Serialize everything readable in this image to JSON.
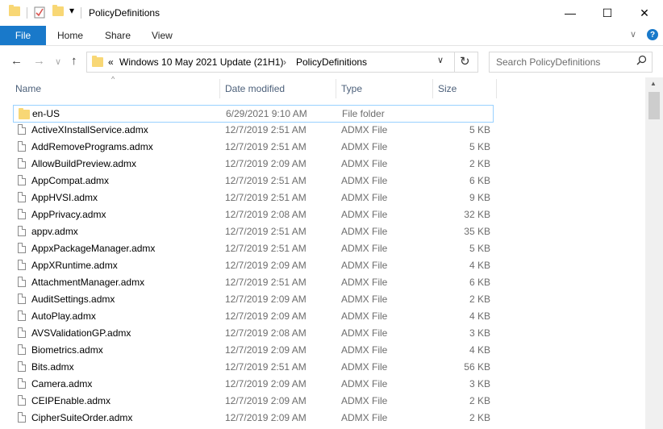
{
  "window": {
    "title": "PolicyDefinitions",
    "minimize_icon": "—",
    "maximize_icon": "☐",
    "close_icon": "✕"
  },
  "quick_access": {
    "dropdown_icon": "▾"
  },
  "ribbon": {
    "tabs": [
      "File",
      "Home",
      "Share",
      "View"
    ],
    "expand_icon": "∨",
    "help_icon": "?"
  },
  "navigation": {
    "back_icon": "←",
    "forward_icon": "→",
    "recent_icon": "∨",
    "up_icon": "↑",
    "overflow": "«",
    "breadcrumb": [
      "Windows 10 May 2021 Update (21H1)",
      "PolicyDefinitions"
    ],
    "crumb_sep": "›",
    "dropdown_icon": "∨",
    "refresh_icon": "↻"
  },
  "search": {
    "placeholder": "Search PolicyDefinitions",
    "icon": "⚲"
  },
  "columns": {
    "name": "Name",
    "date": "Date modified",
    "type": "Type",
    "size": "Size",
    "sort_indicator": "^"
  },
  "files": [
    {
      "name": "en-US",
      "date": "6/29/2021 9:10 AM",
      "type": "File folder",
      "size": "",
      "kind": "folder"
    },
    {
      "name": "ActiveXInstallService.admx",
      "date": "12/7/2019 2:51 AM",
      "type": "ADMX File",
      "size": "5 KB",
      "kind": "file"
    },
    {
      "name": "AddRemovePrograms.admx",
      "date": "12/7/2019 2:51 AM",
      "type": "ADMX File",
      "size": "5 KB",
      "kind": "file"
    },
    {
      "name": "AllowBuildPreview.admx",
      "date": "12/7/2019 2:09 AM",
      "type": "ADMX File",
      "size": "2 KB",
      "kind": "file"
    },
    {
      "name": "AppCompat.admx",
      "date": "12/7/2019 2:51 AM",
      "type": "ADMX File",
      "size": "6 KB",
      "kind": "file"
    },
    {
      "name": "AppHVSI.admx",
      "date": "12/7/2019 2:51 AM",
      "type": "ADMX File",
      "size": "9 KB",
      "kind": "file"
    },
    {
      "name": "AppPrivacy.admx",
      "date": "12/7/2019 2:08 AM",
      "type": "ADMX File",
      "size": "32 KB",
      "kind": "file"
    },
    {
      "name": "appv.admx",
      "date": "12/7/2019 2:51 AM",
      "type": "ADMX File",
      "size": "35 KB",
      "kind": "file"
    },
    {
      "name": "AppxPackageManager.admx",
      "date": "12/7/2019 2:51 AM",
      "type": "ADMX File",
      "size": "5 KB",
      "kind": "file"
    },
    {
      "name": "AppXRuntime.admx",
      "date": "12/7/2019 2:09 AM",
      "type": "ADMX File",
      "size": "4 KB",
      "kind": "file"
    },
    {
      "name": "AttachmentManager.admx",
      "date": "12/7/2019 2:51 AM",
      "type": "ADMX File",
      "size": "6 KB",
      "kind": "file"
    },
    {
      "name": "AuditSettings.admx",
      "date": "12/7/2019 2:09 AM",
      "type": "ADMX File",
      "size": "2 KB",
      "kind": "file"
    },
    {
      "name": "AutoPlay.admx",
      "date": "12/7/2019 2:09 AM",
      "type": "ADMX File",
      "size": "4 KB",
      "kind": "file"
    },
    {
      "name": "AVSValidationGP.admx",
      "date": "12/7/2019 2:08 AM",
      "type": "ADMX File",
      "size": "3 KB",
      "kind": "file"
    },
    {
      "name": "Biometrics.admx",
      "date": "12/7/2019 2:09 AM",
      "type": "ADMX File",
      "size": "4 KB",
      "kind": "file"
    },
    {
      "name": "Bits.admx",
      "date": "12/7/2019 2:51 AM",
      "type": "ADMX File",
      "size": "56 KB",
      "kind": "file"
    },
    {
      "name": "Camera.admx",
      "date": "12/7/2019 2:09 AM",
      "type": "ADMX File",
      "size": "3 KB",
      "kind": "file"
    },
    {
      "name": "CEIPEnable.admx",
      "date": "12/7/2019 2:09 AM",
      "type": "ADMX File",
      "size": "2 KB",
      "kind": "file"
    },
    {
      "name": "CipherSuiteOrder.admx",
      "date": "12/7/2019 2:09 AM",
      "type": "ADMX File",
      "size": "2 KB",
      "kind": "file"
    }
  ],
  "scrollbar": {
    "up_icon": "▲"
  },
  "colors": {
    "accent": "#1979ca",
    "folder": "#f8d775",
    "selection_border": "#99d1ff",
    "header_text": "#4c607a"
  }
}
